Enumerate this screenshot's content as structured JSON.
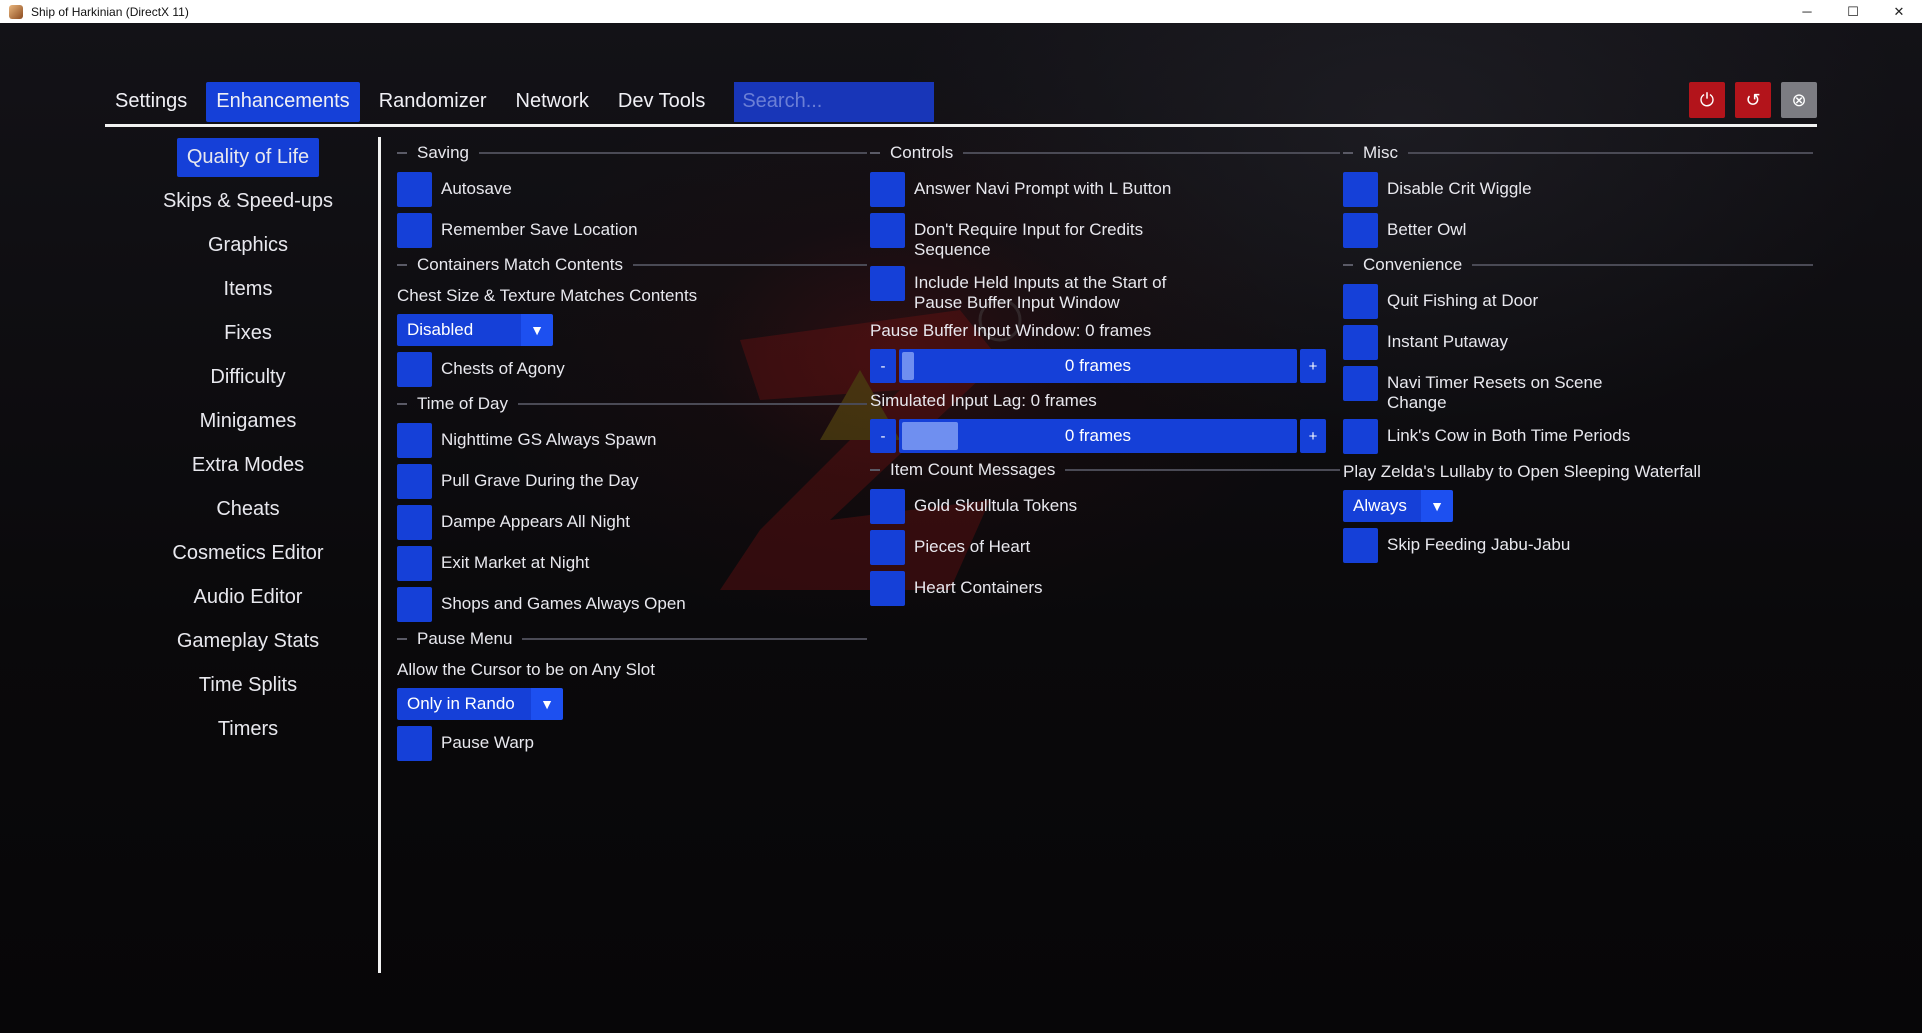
{
  "window": {
    "title": "Ship of Harkinian (DirectX 11)",
    "controls": {
      "minimize": "─",
      "maximize": "☐",
      "close": "✕"
    }
  },
  "menubar": {
    "tabs": [
      "Settings",
      "Enhancements",
      "Randomizer",
      "Network",
      "Dev Tools"
    ],
    "active_tab": "Enhancements",
    "search_placeholder": "Search...",
    "buttons": [
      {
        "name": "power-icon",
        "glyph": "⏻",
        "color": "#b3141b"
      },
      {
        "name": "reset-icon",
        "glyph": "↺",
        "color": "#b3141b"
      },
      {
        "name": "close-circle-icon",
        "glyph": "⊗",
        "color": "#7c7c82"
      }
    ]
  },
  "sidebar": {
    "items": [
      "Quality of Life",
      "Skips & Speed-ups",
      "Graphics",
      "Items",
      "Fixes",
      "Difficulty",
      "Minigames",
      "Extra Modes",
      "Cheats",
      "Cosmetics Editor",
      "Audio Editor",
      "Gameplay Stats",
      "Time Splits",
      "Timers"
    ],
    "active": "Quality of Life"
  },
  "col1": {
    "saving": "Saving",
    "autosave": "Autosave",
    "remember_save": "Remember Save Location",
    "containers": "Containers Match Contents",
    "chest_size_label": "Chest Size & Texture Matches Contents",
    "chest_size_value": "Disabled",
    "chests_agony": "Chests of Agony",
    "time_of_day": "Time of Day",
    "nighttime_gs": "Nighttime GS Always Spawn",
    "pull_grave": "Pull Grave During the Day",
    "dampe": "Dampe Appears All Night",
    "exit_market": "Exit Market at Night",
    "shops_open": "Shops and Games Always Open",
    "pause_menu": "Pause Menu",
    "cursor_label": "Allow the Cursor to be on Any Slot",
    "cursor_value": "Only in Rando",
    "pause_warp": "Pause Warp"
  },
  "col2": {
    "controls": "Controls",
    "answer_navi": "Answer Navi Prompt with L Button",
    "credits": "Don't Require Input for Credits Sequence",
    "held_inputs": "Include Held Inputs at the Start of Pause Buffer Input Window",
    "pause_buffer_label": "Pause Buffer Input Window: 0 frames",
    "pause_buffer_value": "0 frames",
    "pause_buffer_fraction": 0.0,
    "input_lag_label": "Simulated Input Lag: 0 frames",
    "input_lag_value": "0 frames",
    "input_lag_fraction": 0.0,
    "minus": "-",
    "plus": "+",
    "item_count": "Item Count Messages",
    "gold_skulltula": "Gold Skulltula Tokens",
    "pieces_heart": "Pieces of Heart",
    "heart_containers": "Heart Containers"
  },
  "col3": {
    "misc": "Misc",
    "crit_wiggle": "Disable Crit Wiggle",
    "better_owl": "Better Owl",
    "convenience": "Convenience",
    "quit_fishing": "Quit Fishing at Door",
    "instant_putaway": "Instant Putaway",
    "navi_timer": "Navi Timer Resets on Scene Change",
    "links_cow": "Link's Cow in Both Time Periods",
    "lullaby_label": "Play Zelda's Lullaby to Open Sleeping Waterfall",
    "lullaby_value": "Always",
    "skip_jabu": "Skip Feeding Jabu-Jabu"
  },
  "colors": {
    "accent": "#1540d8",
    "accent_light": "#6f8ff0",
    "danger": "#b3141b",
    "divider": "#f2f2f2"
  }
}
